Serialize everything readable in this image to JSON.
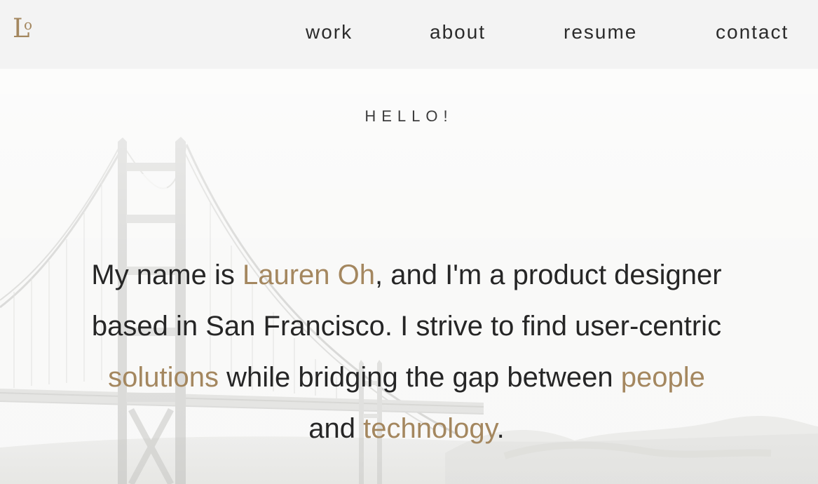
{
  "brand": {
    "logo_letter": "L",
    "logo_small_letter": "o",
    "color": "#a4875f"
  },
  "nav": {
    "items": [
      {
        "label": "work"
      },
      {
        "label": "about"
      },
      {
        "label": "resume"
      },
      {
        "label": "contact"
      }
    ]
  },
  "hero": {
    "greeting": "HELLO!",
    "intro": {
      "text_1": "My name is ",
      "name": "Lauren Oh",
      "text_2": ", and I'm a product designer based in San Francisco. I strive to find user-centric ",
      "solutions": "solutions",
      "text_3": " while bridging the gap between ",
      "people": "people",
      "text_4": " and ",
      "technology": "technology",
      "text_5": "."
    },
    "background_image": "golden-gate-bridge-photo",
    "accent_color": "#a4875f",
    "text_color": "#262626",
    "header_color": "#f3f3f3"
  }
}
